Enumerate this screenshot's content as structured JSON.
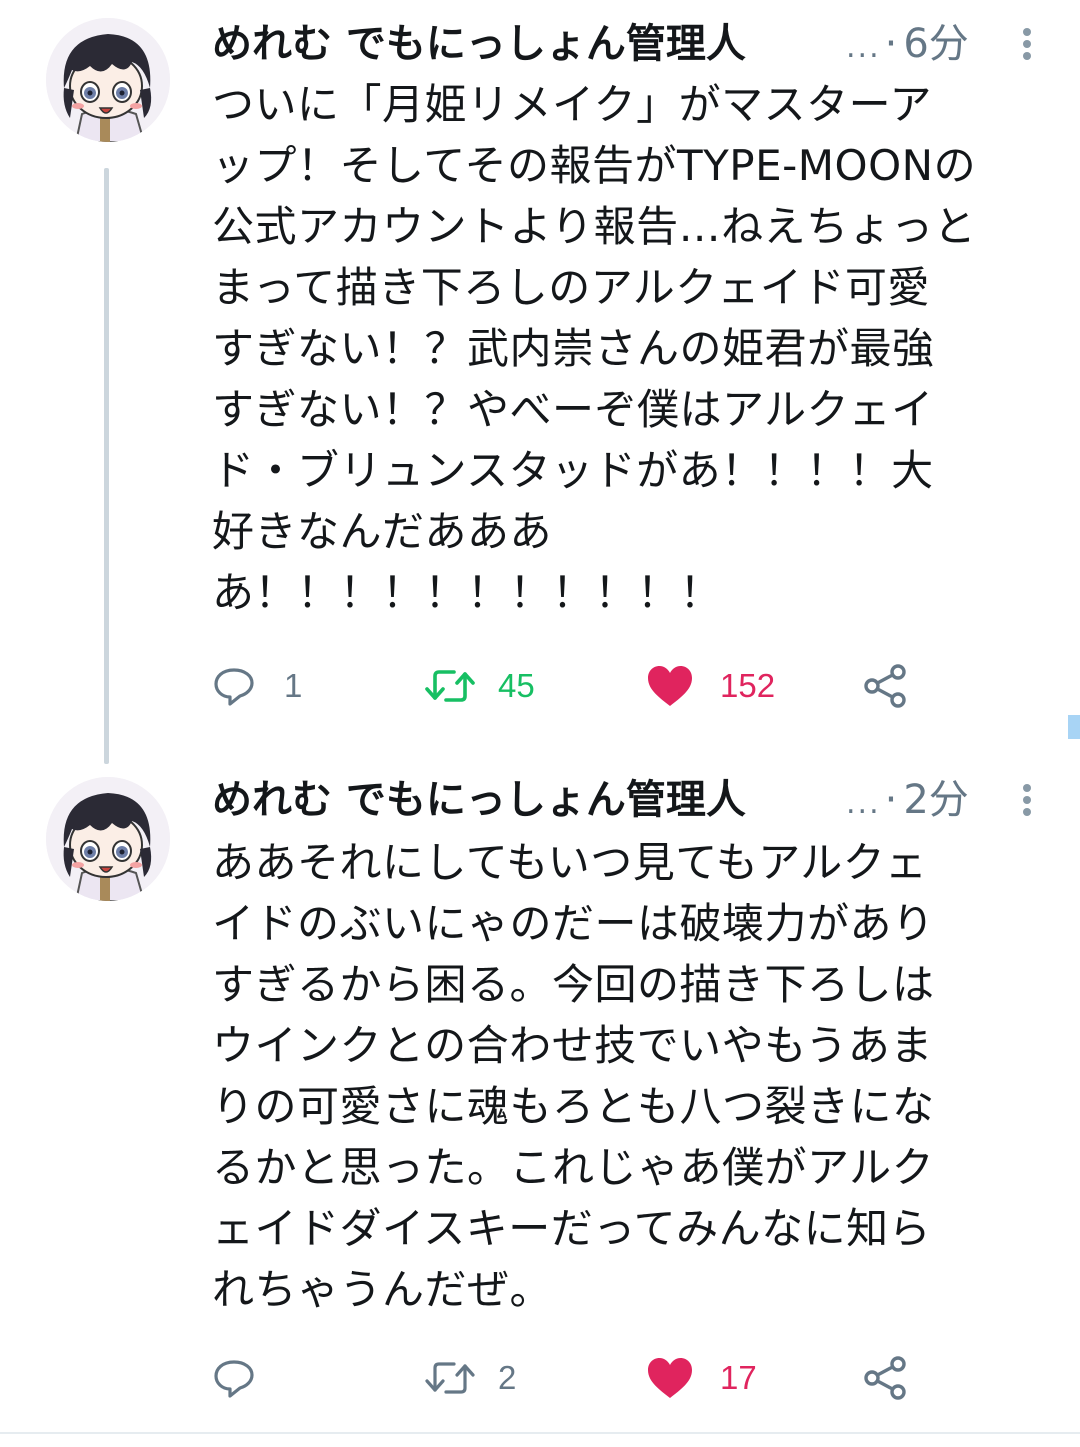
{
  "colors": {
    "text": "#14171a",
    "muted": "#657786",
    "retweet_active": "#17bf63",
    "like_active": "#e0245e",
    "thread_line": "#ccd6dd"
  },
  "tweets": [
    {
      "display_name": "めれむ でもにっしょん管理人",
      "ellipsis": "...",
      "separator": "·",
      "time": "6分",
      "body": "ついに「月姫リメイク」がマスターア\nップ！そしてその報告がTYPE-MOONの\n公式アカウントより報告…ねえちょっと\nまって描き下ろしのアルクェイド可愛\nすぎない！？武内崇さんの姫君が最強\nすぎない！？やべーぞ僕はアルクェイ\nド・ブリュンスタッドがあ！！！！大\n好きなんだあああ\nあ！！！！！！！！！！！",
      "reply_count": "1",
      "retweet_count": "45",
      "like_count": "152",
      "retweeted": true,
      "liked": true,
      "icons": [
        "avatar",
        "more-vertical-icon",
        "reply-icon",
        "retweet-icon",
        "heart-icon",
        "share-icon"
      ]
    },
    {
      "display_name": "めれむ でもにっしょん管理人",
      "ellipsis": "...",
      "separator": "·",
      "time": "2分",
      "body": "ああそれにしてもいつ見てもアルクェ\nイドのぶいにゃのだーは破壊力があり\nすぎるから困る。今回の描き下ろしは\nウインクとの合わせ技でいやもうあま\nりの可愛さに魂もろとも八つ裂きにな\nるかと思った。これじゃあ僕がアルク\nェイドダイスキーだってみんなに知ら\nれちゃうんだぜ。",
      "reply_count": "",
      "retweet_count": "2",
      "like_count": "17",
      "retweeted": false,
      "liked": true,
      "icons": [
        "avatar",
        "more-vertical-icon",
        "reply-icon",
        "retweet-icon",
        "heart-icon",
        "share-icon"
      ]
    }
  ]
}
